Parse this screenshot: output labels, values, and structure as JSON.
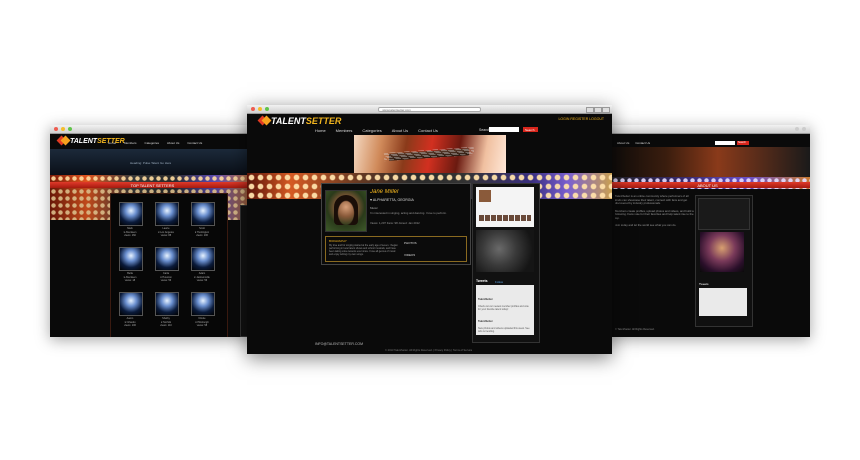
{
  "left": {
    "logo_a": "TALENT",
    "logo_b": "SETTER",
    "nav": [
      "Home",
      "Members",
      "Categories",
      "About Us",
      "Contact Us"
    ],
    "banner_caption": "Heading: Pulse Talent Go Here",
    "section_title": "TOP TALENT SETTERS",
    "cells": [
      {
        "name": "Mark",
        "loc": "♥ Aberdeen",
        "meta": "views: 160"
      },
      {
        "name": "Laurie",
        "loc": "♥ Los Angeles",
        "meta": "views: 88"
      },
      {
        "name": "Scott",
        "loc": "♥ Huntington",
        "meta": "views: 106"
      },
      {
        "name": "Bella",
        "loc": "♥ Aberdeen",
        "meta": "views: 18"
      },
      {
        "name": "Carla",
        "loc": "♥ Houston",
        "meta": "views: 56"
      },
      {
        "name": "Adam",
        "loc": "♥ Jacksonville",
        "meta": "views: 56"
      },
      {
        "name": "Aaron",
        "loc": "♥ Orlando",
        "meta": "views: 106"
      },
      {
        "name": "Shelby",
        "loc": "♥ Norfolk",
        "meta": "views: 110"
      },
      {
        "name": "Nicole",
        "loc": "♥ Pittsburgh",
        "meta": "views: 58"
      }
    ]
  },
  "center": {
    "url": "www.talentsetter.com",
    "logo_a": "TALENT",
    "logo_b": "SETTER",
    "top_links": "LOGIN  REGISTER  LOGOUT",
    "nav": [
      "Home",
      "Members",
      "Categories",
      "About Us",
      "Contact Us"
    ],
    "search_label": "Search",
    "search_placeholder": "",
    "search_button": "Search",
    "profile": {
      "name": "Jane Miller",
      "location": "♥ ALPHARETTA, GEORGIA",
      "category": "Music",
      "desc": "I'm interested in singing, acting and dancing. I love to perform.",
      "stats": "Views: 1,207   Fans: 98   Joined: Jan 2012"
    },
    "bio_heading": "BIOGRAPHY",
    "bio_text": "My love and for singing started at the early age of seven. I began performing in local talent shows and school musicals, and have been taking voice lessons ever since. I love all genres of music and enjoy writing my own songs.",
    "sidebar_links": [
      "PHOTOS",
      "VIDEOS"
    ],
    "tweets_heading": "Tweets",
    "tweets_follow": "Follow",
    "tweets": [
      {
        "user": "TalentSetter",
        "text": "Check out our newest member profiles and vote for your favorite talent today!"
      },
      {
        "user": "TalentSetter",
        "text": "New photos and videos uploaded this week. See who is trending."
      }
    ],
    "footer_site": "INFO@TALENTSETTER.COM",
    "footer_copy": "© 2013 TalentSetter. All Rights Reserved. | Privacy Policy | Terms of Service"
  },
  "right": {
    "nav": [
      "About Us",
      "Contact Us"
    ],
    "search_button": "Search",
    "section_title": "ABOUT US",
    "paragraphs": [
      "TalentSetter is an online community where performers of all kinds can showcase their talent, connect with fans and get discovered by industry professionals.",
      "Members create profiles, upload photos and videos, and build a following. Fans vote for their favorites and help talent rise to the top.",
      "Join today and let the world see what you can do."
    ],
    "tweets_heading": "Tweets",
    "footer": "© TalentSetter. All Rights Reserved."
  },
  "colors": {
    "accent_red": "#d9261c",
    "accent_gold": "#f2b51f",
    "page_bg": "#0a0a0a"
  }
}
